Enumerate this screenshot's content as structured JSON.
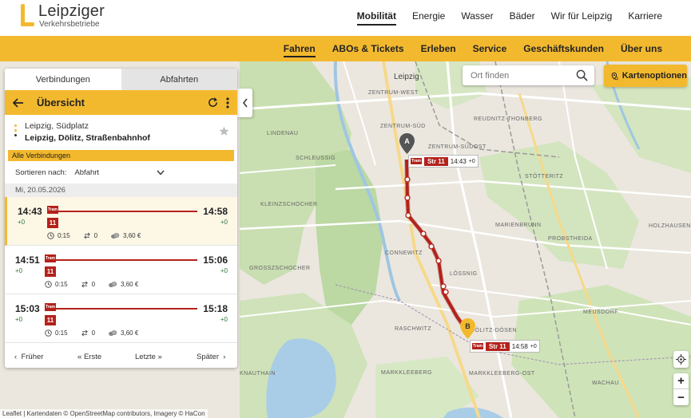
{
  "header": {
    "logo_name": "Leipziger",
    "logo_sub": "Verkehrsbetriebe",
    "main_nav": [
      "Mobilität",
      "Energie",
      "Wasser",
      "Bäder",
      "Wir für Leipzig",
      "Karriere"
    ],
    "sub_nav": [
      "Fahren",
      "ABOs & Tickets",
      "Erleben",
      "Service",
      "Geschäftskunden",
      "Über uns"
    ]
  },
  "map": {
    "search_placeholder": "Ort finden",
    "options_label": "Kartenoptionen",
    "attribution": "Leaflet | Kartendaten © OpenStreetMap contributors, Imagery © HaCon",
    "city_label": "Leipzig",
    "district_labels": [
      "ZENTRUM-WEST",
      "ZENTRUM-SÜD",
      "ZENTRUM-SÜDOST",
      "LINDENAU",
      "SCHLEUSSIG",
      "KLEINZSCHOCHER",
      "CONNEWITZ",
      "GROSSZSCHOCHER",
      "LÖSSNIG",
      "DÖLITZ-DÖSEN",
      "RASCHWITZ",
      "MARKKLEEBERG",
      "PROBSTHEIDA",
      "STÖTTERITZ",
      "HOLZHAUSEN",
      "MEUSDORF",
      "REUDNITZ-THONBERG",
      "MARIENBRUNN",
      "WACHAU",
      "KNAUTHAIN",
      "MARKKLEEBERG-OST"
    ],
    "marker_a": "A",
    "marker_b": "B",
    "tag_start": {
      "tram": "Tram",
      "line": "Str 11",
      "time": "14:43",
      "delay": "+0"
    },
    "tag_end": {
      "tram": "Tram",
      "line": "Str 11",
      "time": "14:58",
      "delay": "+0"
    },
    "zoom_in": "+",
    "zoom_out": "−"
  },
  "panel": {
    "tab_connections": "Verbindungen",
    "tab_departures": "Abfahrten",
    "overview_title": "Übersicht",
    "from": "Leipzig, Südplatz",
    "to": "Leipzig, Dölitz, Straßenbahnhof",
    "all_connections": "Alle Verbindungen",
    "sort_label": "Sortieren nach:",
    "sort_value": "Abfahrt",
    "date": "Mi, 20.05.2026",
    "connections": [
      {
        "dep": "14:43",
        "dep_delay": "+0",
        "arr": "14:58",
        "arr_delay": "+0",
        "tram": "Tram",
        "line": "11",
        "duration": "0:15",
        "changes": "0",
        "price": "3,60 €"
      },
      {
        "dep": "14:51",
        "dep_delay": "+0",
        "arr": "15:06",
        "arr_delay": "+0",
        "tram": "Tram",
        "line": "11",
        "duration": "0:15",
        "changes": "0",
        "price": "3,60 €"
      },
      {
        "dep": "15:03",
        "dep_delay": "+0",
        "arr": "15:18",
        "arr_delay": "+0",
        "tram": "Tram",
        "line": "11",
        "duration": "0:15",
        "changes": "0",
        "price": "3,60 €"
      }
    ],
    "pager": {
      "earlier": "Früher",
      "first": "Erste",
      "last": "Letzte",
      "later": "Später"
    }
  },
  "colors": {
    "brand_yellow": "#f3b92e",
    "tram_red": "#b3221b",
    "delay_green": "#2a7a3c"
  }
}
